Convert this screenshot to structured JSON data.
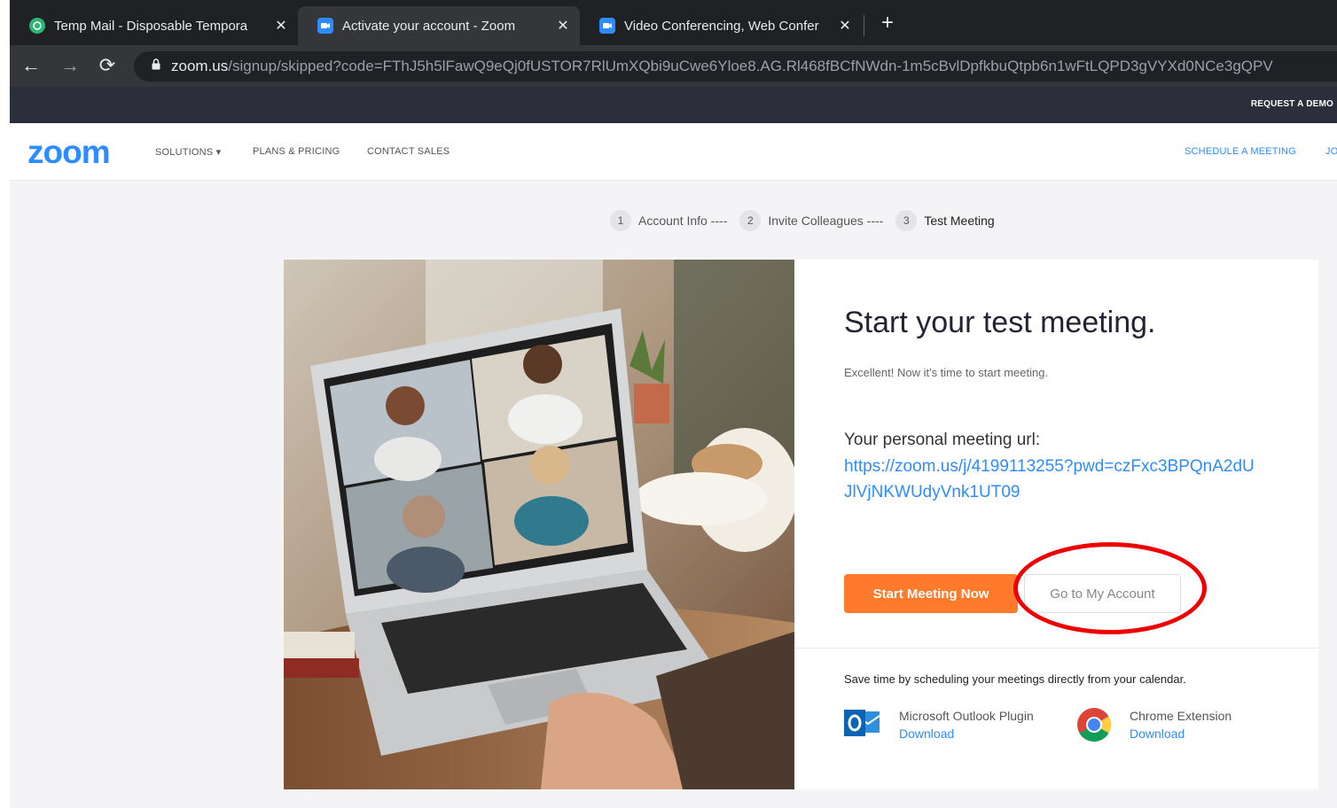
{
  "browser": {
    "tabs": [
      {
        "title": "Temp Mail - Disposable Tempora",
        "active": false,
        "icon": "tempmail-favicon"
      },
      {
        "title": "Activate your account - Zoom",
        "active": true,
        "icon": "zoom-favicon"
      },
      {
        "title": "Video Conferencing, Web Confer",
        "active": false,
        "icon": "zoom-favicon"
      }
    ],
    "new_tab": "+",
    "close_glyph": "✕",
    "url_host": "zoom.us",
    "url_path": "/signup/skipped?code=FThJ5h5lFawQ9eQj0fUSTOR7RlUmXQbi9uCwe6Yloe8.AG.Rl468fBCfNWdn-1m5cBvlDpfkbuQtpb6n1wFtLQPD3gVYXd0NCe3gQPV"
  },
  "zoom_header": {
    "request_demo": "REQUEST A DEMO",
    "logo": "zoom",
    "nav": [
      "SOLUTIONS ▾",
      "PLANS & PRICING",
      "CONTACT SALES"
    ],
    "schedule": "SCHEDULE A MEETING",
    "join_partial": "JO"
  },
  "steps": [
    {
      "num": "1",
      "label": "Account Info ----"
    },
    {
      "num": "2",
      "label": "Invite Colleagues ----"
    },
    {
      "num": "3",
      "label": "Test Meeting"
    }
  ],
  "main": {
    "heading": "Start your test meeting.",
    "subtext": "Excellent! Now it's time to start meeting.",
    "url_label": "Your personal meeting url:",
    "meeting_url": "https://zoom.us/j/4199113255?pwd=czFxc3BPQnA2dUJlVjNKWUdyVnk1UT09",
    "start_button": "Start Meeting Now",
    "account_button": "Go to My Account",
    "calendar_text": "Save time by scheduling your meetings directly from your calendar.",
    "plugins": [
      {
        "name": "Microsoft Outlook Plugin",
        "action": "Download",
        "icon": "outlook-icon"
      },
      {
        "name": "Chrome Extension",
        "action": "Download",
        "icon": "chrome-icon"
      }
    ]
  },
  "colors": {
    "zoom_blue": "#2d8cff",
    "orange": "#ff7a2b",
    "annotation_red": "#e00000"
  }
}
